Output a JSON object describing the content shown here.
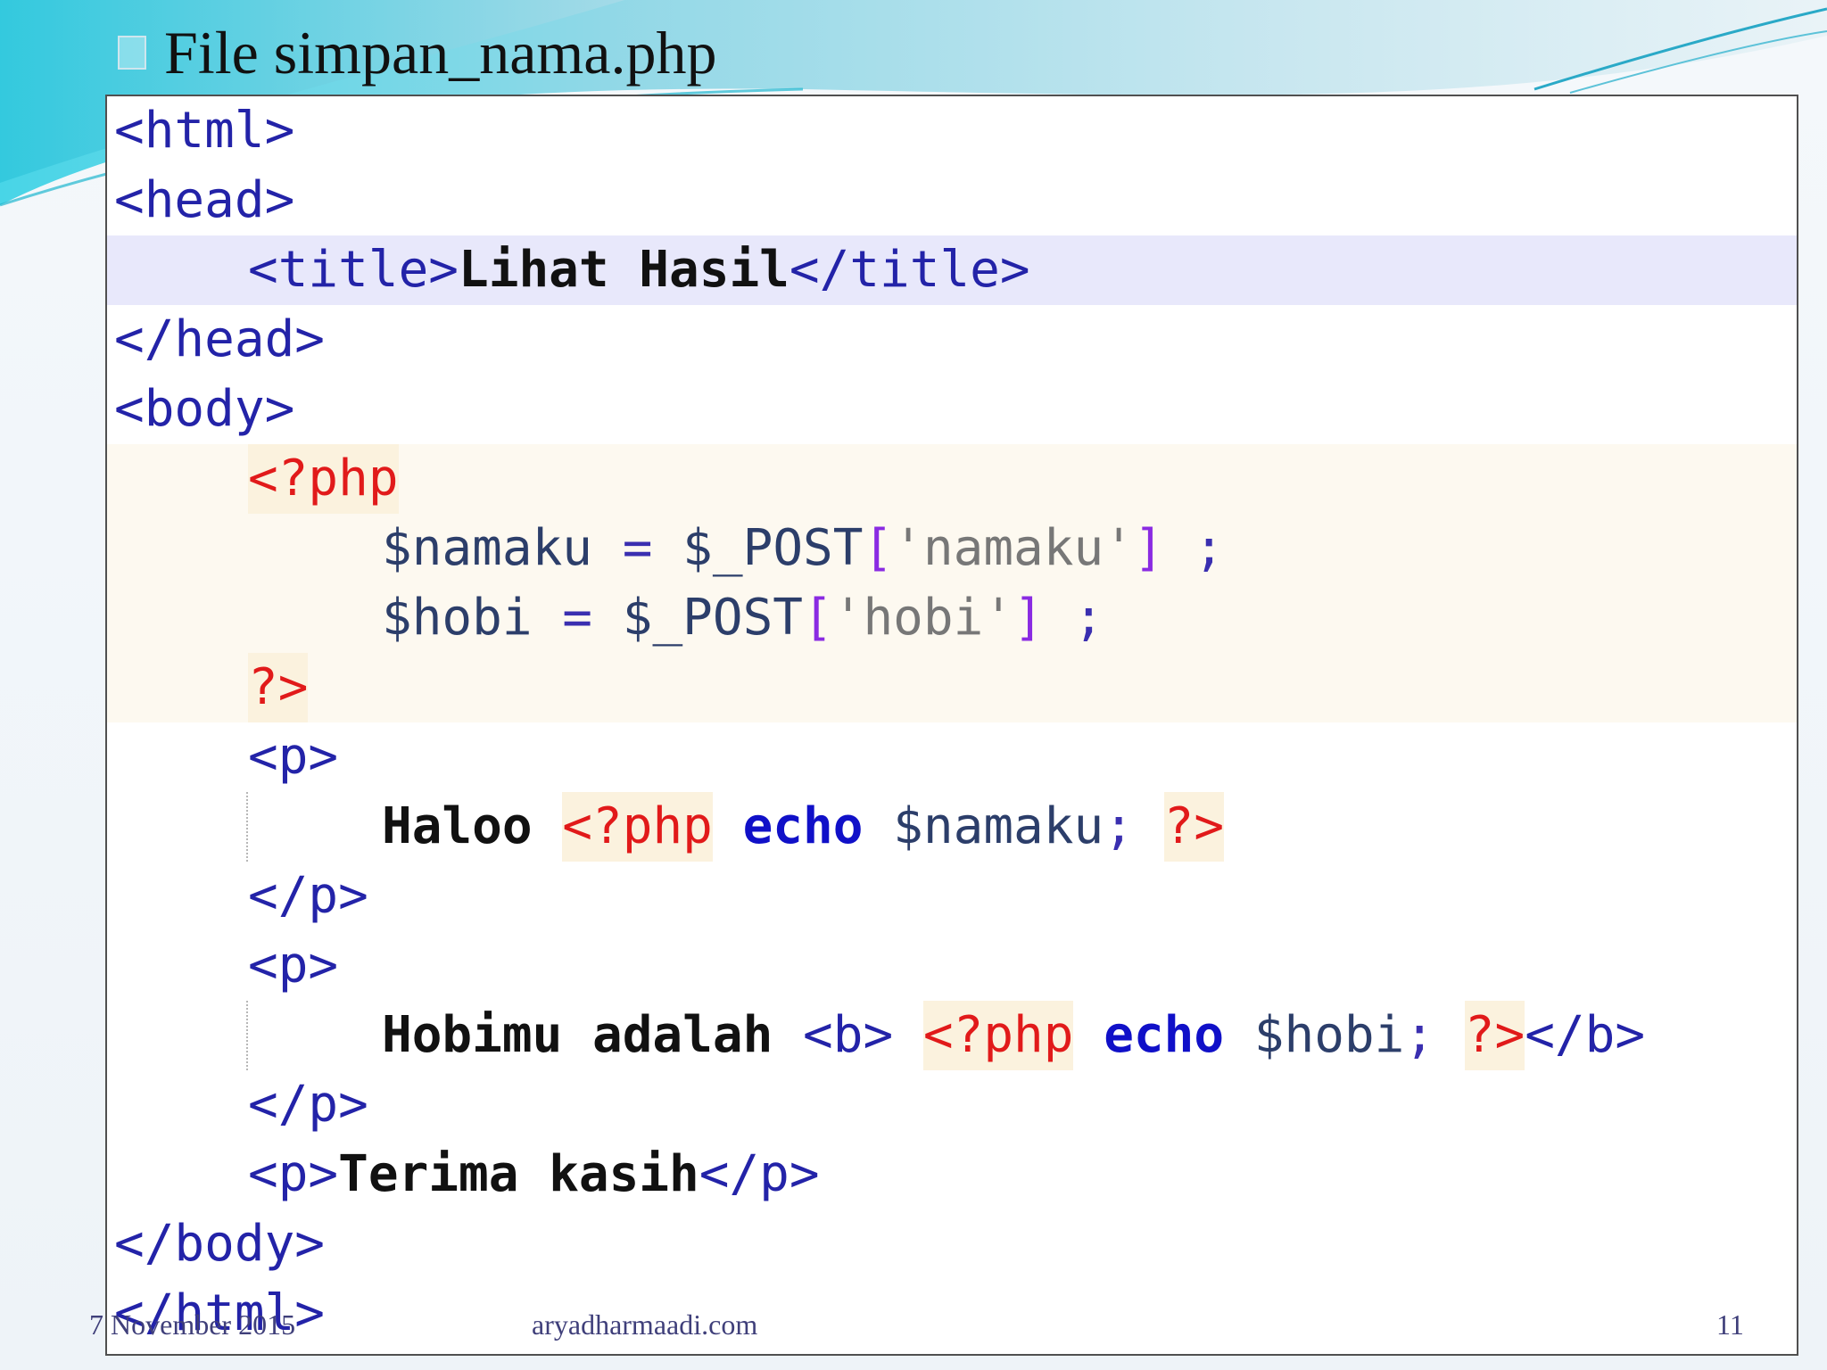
{
  "slide": {
    "title": "File simpan_nama.php",
    "footer_date": "7 November 2015",
    "footer_site": "aryadharmaadi.com",
    "page_number": "11"
  },
  "code": {
    "lines": [
      {
        "selected": false,
        "php_band": false,
        "indent": 0,
        "tokens": [
          {
            "t": "<html>",
            "c": "tag"
          }
        ]
      },
      {
        "selected": false,
        "php_band": false,
        "indent": 0,
        "tokens": [
          {
            "t": "<head>",
            "c": "tag"
          }
        ]
      },
      {
        "selected": true,
        "php_band": false,
        "indent": 4,
        "tokens": [
          {
            "t": "<title>",
            "c": "tag"
          },
          {
            "t": "Lihat Hasil",
            "c": "bold"
          },
          {
            "t": "</title>",
            "c": "tag"
          }
        ]
      },
      {
        "selected": false,
        "php_band": false,
        "indent": 0,
        "tokens": [
          {
            "t": "</head>",
            "c": "tag"
          }
        ]
      },
      {
        "selected": false,
        "php_band": false,
        "indent": 0,
        "tokens": [
          {
            "t": "<body>",
            "c": "tag"
          }
        ]
      },
      {
        "selected": false,
        "php_band": true,
        "indent": 4,
        "tokens": [
          {
            "t": "<?php",
            "c": "php"
          }
        ]
      },
      {
        "selected": false,
        "php_band": true,
        "indent": 8,
        "tokens": [
          {
            "t": "$namaku",
            "c": "var"
          },
          {
            "t": " = ",
            "c": "op"
          },
          {
            "t": "$_POST",
            "c": "var"
          },
          {
            "t": "[",
            "c": "br"
          },
          {
            "t": "'namaku'",
            "c": "str"
          },
          {
            "t": "]",
            "c": "br"
          },
          {
            "t": " ;",
            "c": "semi"
          }
        ]
      },
      {
        "selected": false,
        "php_band": true,
        "indent": 8,
        "tokens": [
          {
            "t": "$hobi",
            "c": "var"
          },
          {
            "t": " = ",
            "c": "op"
          },
          {
            "t": "$_POST",
            "c": "var"
          },
          {
            "t": "[",
            "c": "br"
          },
          {
            "t": "'hobi'",
            "c": "str"
          },
          {
            "t": "]",
            "c": "br"
          },
          {
            "t": " ;",
            "c": "semi"
          }
        ]
      },
      {
        "selected": false,
        "php_band": true,
        "indent": 4,
        "tokens": [
          {
            "t": "?>",
            "c": "php"
          }
        ]
      },
      {
        "selected": false,
        "php_band": false,
        "indent": 4,
        "tokens": [
          {
            "t": "<p>",
            "c": "tag"
          }
        ]
      },
      {
        "selected": false,
        "php_band": false,
        "indent": 8,
        "tokens": [
          {
            "t": "Haloo ",
            "c": "bold"
          },
          {
            "t": "<?php",
            "c": "php"
          },
          {
            "t": " ",
            "c": ""
          },
          {
            "t": "echo",
            "c": "kw"
          },
          {
            "t": " ",
            "c": ""
          },
          {
            "t": "$namaku",
            "c": "var"
          },
          {
            "t": ";",
            "c": "semi"
          },
          {
            "t": " ",
            "c": ""
          },
          {
            "t": "?>",
            "c": "php"
          }
        ]
      },
      {
        "selected": false,
        "php_band": false,
        "indent": 4,
        "tokens": [
          {
            "t": "</p>",
            "c": "tag"
          }
        ]
      },
      {
        "selected": false,
        "php_band": false,
        "indent": 4,
        "tokens": [
          {
            "t": "<p>",
            "c": "tag"
          }
        ]
      },
      {
        "selected": false,
        "php_band": false,
        "indent": 8,
        "tokens": [
          {
            "t": "Hobimu adalah ",
            "c": "bold"
          },
          {
            "t": "<b>",
            "c": "tag"
          },
          {
            "t": " ",
            "c": ""
          },
          {
            "t": "<?php",
            "c": "php"
          },
          {
            "t": " ",
            "c": ""
          },
          {
            "t": "echo",
            "c": "kw"
          },
          {
            "t": " ",
            "c": ""
          },
          {
            "t": "$hobi",
            "c": "var"
          },
          {
            "t": ";",
            "c": "semi"
          },
          {
            "t": " ",
            "c": ""
          },
          {
            "t": "?>",
            "c": "php"
          },
          {
            "t": "</b>",
            "c": "tag"
          }
        ]
      },
      {
        "selected": false,
        "php_band": false,
        "indent": 4,
        "tokens": [
          {
            "t": "</p>",
            "c": "tag"
          }
        ]
      },
      {
        "selected": false,
        "php_band": false,
        "indent": 4,
        "tokens": [
          {
            "t": "<p>",
            "c": "tag"
          },
          {
            "t": "Terima kasih",
            "c": "bold"
          },
          {
            "t": "</p>",
            "c": "tag"
          }
        ]
      },
      {
        "selected": false,
        "php_band": false,
        "indent": 0,
        "tokens": [
          {
            "t": "</body>",
            "c": "tag"
          }
        ]
      },
      {
        "selected": false,
        "php_band": false,
        "indent": 0,
        "tokens": [
          {
            "t": "</html>",
            "c": "tag"
          }
        ]
      }
    ]
  }
}
